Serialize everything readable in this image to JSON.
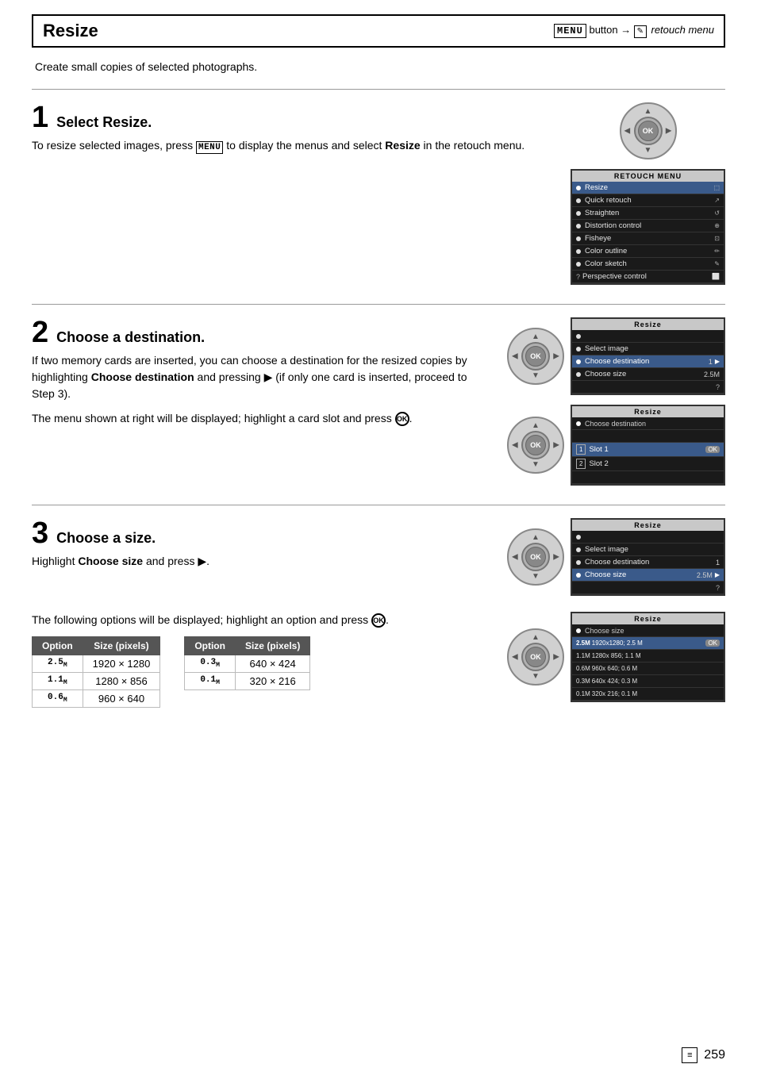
{
  "header": {
    "title": "Resize",
    "menu_label": "MENU",
    "button_text": "button",
    "arrow": "→",
    "retouch_label": "retouch menu"
  },
  "intro": "Create small copies of selected photographs.",
  "steps": [
    {
      "number": "1",
      "title": "Select Resize.",
      "body": "To resize selected images, press MENU to display the menus and select Resize in the retouch menu.",
      "screen": {
        "header": "RETOUCH MENU",
        "items": [
          {
            "label": "Resize",
            "highlighted": true
          },
          {
            "label": "Quick retouch"
          },
          {
            "label": "Straighten"
          },
          {
            "label": "Distortion control"
          },
          {
            "label": "Fisheye"
          },
          {
            "label": "Color outline"
          },
          {
            "label": "Color sketch"
          },
          {
            "label": "Perspective control"
          }
        ]
      }
    },
    {
      "number": "2",
      "title": "Choose a destination.",
      "body1": "If two memory cards are inserted, you can choose a destination for the resized copies by highlighting Choose destination and pressing ▶ (if only one card is inserted, proceed to Step 3).",
      "body2": "The menu shown at right will be displayed; highlight a card slot and press ⊛.",
      "screen1": {
        "title": "Resize",
        "items": [
          {
            "label": "Select image"
          },
          {
            "label": "Choose destination",
            "highlighted": true,
            "value": "1 ▶"
          },
          {
            "label": "Choose size",
            "value": "2.5M"
          }
        ]
      },
      "screen2": {
        "title": "Resize",
        "subtitle": "Choose destination",
        "items": [
          {
            "label": "Slot 1",
            "slot": "1",
            "highlighted": true,
            "ok": true
          },
          {
            "label": "Slot 2",
            "slot": "2"
          }
        ]
      }
    },
    {
      "number": "3",
      "title": "Choose a size.",
      "body": "Highlight Choose size and press ▶.",
      "body2": "The following options will be displayed; highlight an option and press ⊛.",
      "screen1": {
        "title": "Resize",
        "items": [
          {
            "label": "Select image"
          },
          {
            "label": "Choose destination",
            "value": "1"
          },
          {
            "label": "Choose size",
            "highlighted": true,
            "value": "2.5M ▶"
          }
        ]
      },
      "screen2": {
        "title": "Resize",
        "subtitle": "Choose size",
        "items": [
          {
            "label": "2.5M 1920x1280; 2.5 M",
            "highlighted": true,
            "ok": true
          },
          {
            "label": "1.1M 1280x 856; 1.1 M"
          },
          {
            "label": "0.6M 960x 640; 0.6 M"
          },
          {
            "label": "0.3M 640x 424; 0.3 M"
          },
          {
            "label": "0.1M 320x 216; 0.1 M"
          }
        ]
      },
      "table1": {
        "headers": [
          "Option",
          "Size (pixels)"
        ],
        "rows": [
          {
            "option": "2.5M",
            "size": "1920 × 1280"
          },
          {
            "option": "1.1M",
            "size": "1280 × 856"
          },
          {
            "option": "0.6M",
            "size": "960 × 640"
          }
        ]
      },
      "table2": {
        "headers": [
          "Option",
          "Size (pixels)"
        ],
        "rows": [
          {
            "option": "0.3M",
            "size": "640 × 424"
          },
          {
            "option": "0.1M",
            "size": "320 × 216"
          }
        ]
      }
    }
  ],
  "page_number": "259"
}
